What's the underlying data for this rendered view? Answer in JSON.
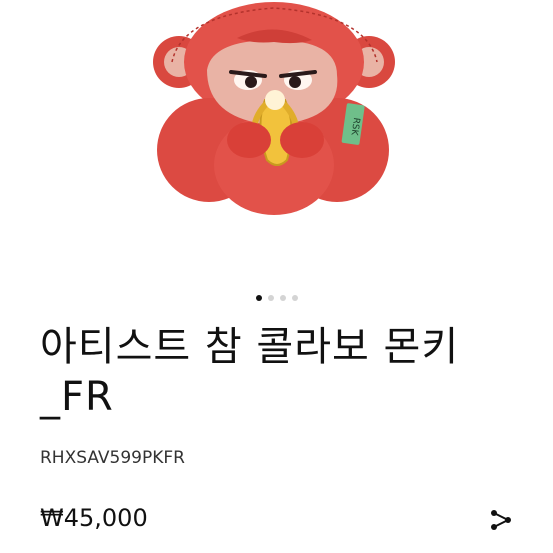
{
  "product": {
    "title": "아티스트 참 콜라보 몬키\n_FR",
    "sku": "RHXSAV599PKFR",
    "price": "₩45,000",
    "tag_text": "RSK"
  },
  "carousel": {
    "total": 4,
    "active_index": 0
  },
  "icons": {
    "share": "share-icon"
  },
  "colors": {
    "monkey_red": "#e2524a",
    "banana_yellow": "#f2c23c",
    "tag_green": "#6fbf8a"
  }
}
